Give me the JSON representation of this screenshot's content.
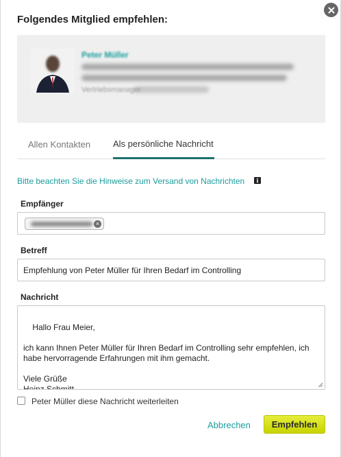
{
  "dialog": {
    "title": "Folgendes Mitglied empfehlen:"
  },
  "profile": {
    "name": "Peter Müller",
    "extra_text": "Vertriebsmanager"
  },
  "tabs": [
    {
      "label": "Allen Kontakten",
      "active": false
    },
    {
      "label": "Als persönliche Nachricht",
      "active": true
    }
  ],
  "hint": {
    "text": "Bitte beachten Sie die Hinweise zum Versand von Nachrichten",
    "icon": "info-icon"
  },
  "form": {
    "recipient_label": "Empfänger",
    "subject_label": "Betreff",
    "subject_value": "Empfehlung von Peter Müller für Ihren Bedarf im Controlling",
    "message_label": "Nachricht",
    "message_value": "Hallo Frau Meier,\n\nich kann Ihnen Peter Müller für Ihren Bedarf im Controlling sehr empfehlen, ich habe hervorragende Erfahrungen mit ihm gemacht.\n\nViele Grüße\nHeinz Schmitt",
    "forward_label": "Peter Müller diese Nachricht weiterleiten",
    "forward_checked": false
  },
  "actions": {
    "cancel_label": "Abbrechen",
    "submit_label": "Empfehlen"
  },
  "colors": {
    "accent": "#1a9d9d",
    "tab_underline": "#1a7070",
    "submit": "#d4df10"
  }
}
